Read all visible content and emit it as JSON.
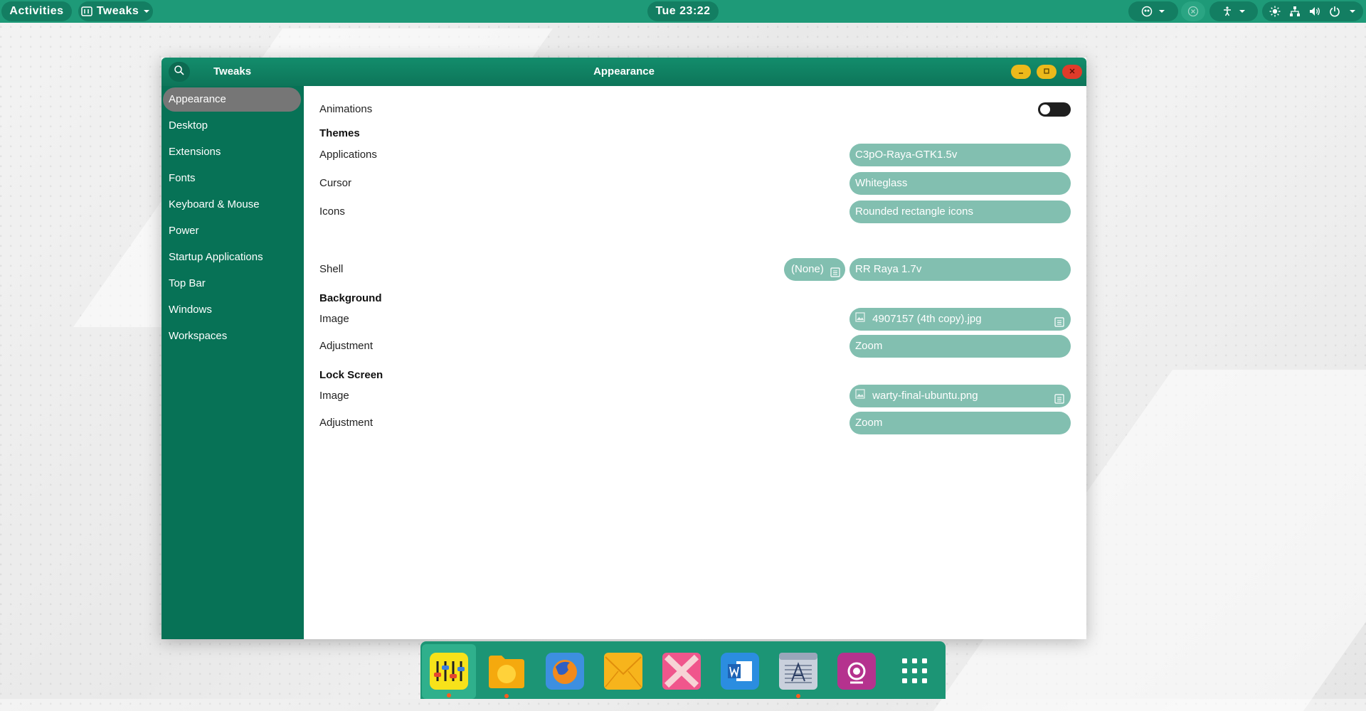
{
  "topbar": {
    "activities": "Activities",
    "app_menu": "Tweaks",
    "clock": "Tue 23:22"
  },
  "window": {
    "app_title": "Tweaks",
    "title": "Appearance"
  },
  "sidebar": {
    "items": [
      {
        "label": "Appearance",
        "active": true
      },
      {
        "label": "Desktop"
      },
      {
        "label": "Extensions"
      },
      {
        "label": "Fonts"
      },
      {
        "label": "Keyboard & Mouse"
      },
      {
        "label": "Power"
      },
      {
        "label": "Startup Applications"
      },
      {
        "label": "Top Bar"
      },
      {
        "label": "Windows"
      },
      {
        "label": "Workspaces"
      }
    ]
  },
  "content": {
    "animations_label": "Animations",
    "animations_on": false,
    "themes_title": "Themes",
    "applications_label": "Applications",
    "applications_value": "C3pO-Raya-GTK1.5v",
    "cursor_label": "Cursor",
    "cursor_value": "Whiteglass",
    "icons_label": "Icons",
    "icons_value": "Rounded rectangle icons",
    "shell_label": "Shell",
    "shell_none": "(None)",
    "shell_value": "RR Raya 1.7v",
    "background_title": "Background",
    "bg_image_label": "Image",
    "bg_image_value": "4907157 (4th copy).jpg",
    "bg_adjust_label": "Adjustment",
    "bg_adjust_value": "Zoom",
    "lock_title": "Lock Screen",
    "lock_image_label": "Image",
    "lock_image_value": "warty-final-ubuntu.png",
    "lock_adjust_label": "Adjustment",
    "lock_adjust_value": "Zoom"
  },
  "dock": {
    "items": [
      {
        "icon": "equalizer-tweaks-icon",
        "running": true
      },
      {
        "icon": "folder-icon",
        "running": true
      },
      {
        "icon": "firefox-icon",
        "running": false
      },
      {
        "icon": "mail-icon",
        "running": false
      },
      {
        "icon": "x-app-icon",
        "running": false
      },
      {
        "icon": "word-icon",
        "running": false
      },
      {
        "icon": "text-editor-icon",
        "running": true
      },
      {
        "icon": "screenshot-icon",
        "running": false
      },
      {
        "icon": "app-grid-icon",
        "running": false
      }
    ]
  },
  "colors": {
    "topbar": "#1e9a78",
    "sidebar": "#077256",
    "field": "#82bfb0",
    "accent_dot": "#ff5a1f"
  }
}
